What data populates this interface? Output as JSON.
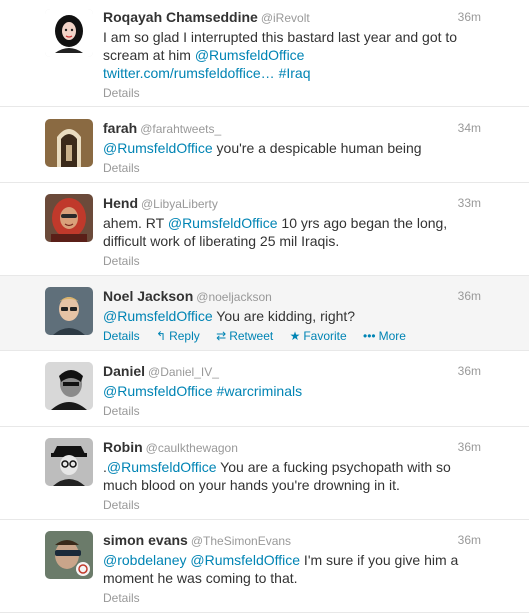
{
  "tweets": [
    {
      "fullname": "Roqayah Chamseddine",
      "username": "@iRevolt",
      "time": "36m",
      "line1": "I am so glad I interrupted this bastard last year and got to",
      "line2a": "scream at him ",
      "line2b": "@RumsfeldOffice",
      "line3a": "twitter.com/rumsfeldoffice…",
      "line3b": " #Iraq",
      "details": "Details"
    },
    {
      "fullname": "farah",
      "username": "@farahtweets_",
      "time": "34m",
      "mention": "@RumsfeldOffice",
      "rest": " you're a despicable human being",
      "details": "Details"
    },
    {
      "fullname": "Hend",
      "username": "@LibyaLiberty",
      "time": "33m",
      "line1a": "ahem. RT ",
      "line1b": "@RumsfeldOffice",
      "line1c": " 10 yrs ago began the long,",
      "line2": "difficult work of liberating 25 mil Iraqis.",
      "details": "Details"
    },
    {
      "fullname": "Noel Jackson",
      "username": "@noeljackson",
      "time": "36m",
      "mention": "@RumsfeldOffice",
      "rest": " You are kidding, right?",
      "details": "Details",
      "reply": "Reply",
      "retweet": "Retweet",
      "favorite": "Favorite",
      "more": "More"
    },
    {
      "fullname": "Daniel",
      "username": "@Daniel_IV_",
      "time": "36m",
      "mention": "@RumsfeldOffice",
      "hashtag": "#warcriminals",
      "details": "Details"
    },
    {
      "fullname": "Robin",
      "username": "@caulkthewagon",
      "time": "36m",
      "line1a": ".",
      "line1b": "@RumsfeldOffice",
      "line1c": " You are a fucking psychopath with so",
      "line2": "much blood on your hands you're drowning in it.",
      "details": "Details"
    },
    {
      "fullname": "simon evans",
      "username": "@TheSimonEvans",
      "time": "36m",
      "mention1": "@robdelaney",
      "mention2": "@RumsfeldOffice",
      "line1c": " I'm sure if you give him a",
      "line2": "moment he was coming to that.",
      "details": "Details"
    }
  ],
  "colors": {
    "link": "#0084b4",
    "meta": "#999999",
    "text": "#333333",
    "hover_bg": "#f5f5f5"
  },
  "icons": [
    "reply-icon",
    "retweet-icon",
    "favorite-icon",
    "more-icon"
  ]
}
